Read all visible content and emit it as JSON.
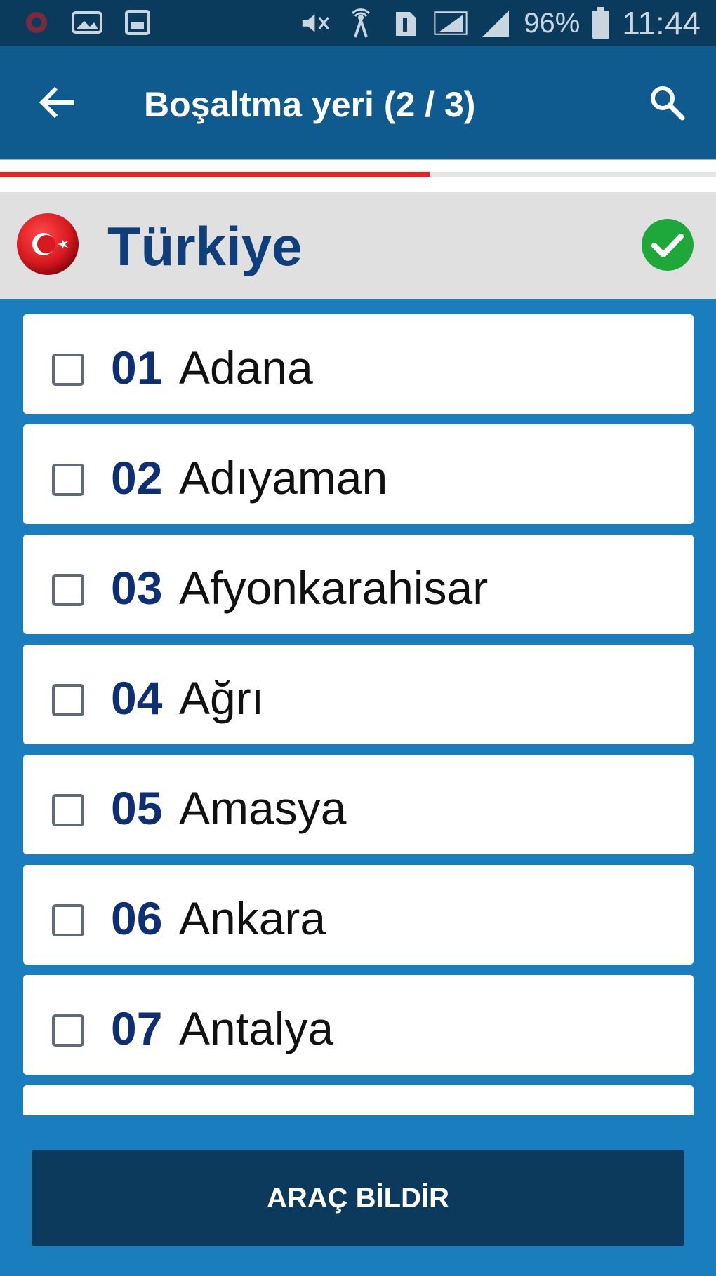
{
  "status_bar": {
    "battery": "96%",
    "time": "11:44"
  },
  "app_bar": {
    "title": "Boşaltma yeri (2 / 3)"
  },
  "progress": {
    "fraction": 0.6,
    "color": "#ee1f23"
  },
  "country": {
    "name": "Türkiye",
    "selected": true
  },
  "cities": [
    {
      "code": "01",
      "name": "Adana"
    },
    {
      "code": "02",
      "name": "Adıyaman"
    },
    {
      "code": "03",
      "name": "Afyonkarahisar"
    },
    {
      "code": "04",
      "name": "Ağrı"
    },
    {
      "code": "05",
      "name": "Amasya"
    },
    {
      "code": "06",
      "name": "Ankara"
    },
    {
      "code": "07",
      "name": "Antalya"
    },
    {
      "code": "",
      "name": ""
    }
  ],
  "footer": {
    "button_label": "ARAÇ BİLDİR"
  },
  "colors": {
    "app_bar": "#0f5a8e",
    "status_bar": "#0a3a5c",
    "list_background": "#1a7dbd",
    "button": "#0b3a5c",
    "check": "#1ea83a",
    "flag_red": "#d8191f"
  }
}
